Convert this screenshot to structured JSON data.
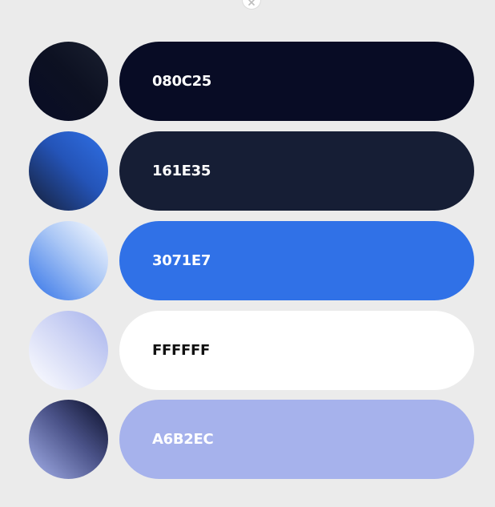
{
  "close_icon": "close-icon",
  "colors": [
    {
      "hex": "080C25",
      "text_color": "#ffffff",
      "pill_color": "#080c25",
      "swatch_gradient": [
        "#1a2030",
        "#0d1122",
        "#080c25"
      ]
    },
    {
      "hex": "161E35",
      "text_color": "#ffffff",
      "pill_color": "#161e35",
      "swatch_gradient": [
        "#3071e7",
        "#2454b8",
        "#161e35"
      ]
    },
    {
      "hex": "3071E7",
      "text_color": "#ffffff",
      "pill_color": "#3071e7",
      "swatch_gradient": [
        "#ffffff",
        "#a9c6f5",
        "#3071e7"
      ]
    },
    {
      "hex": "FFFFFF",
      "text_color": "#111111",
      "pill_color": "#ffffff",
      "swatch_gradient": [
        "#a6b2ec",
        "#d0d6f5",
        "#ffffff"
      ]
    },
    {
      "hex": "A6B2EC",
      "text_color": "#ffffff",
      "pill_color": "#a6b2ec",
      "swatch_gradient": [
        "#080c25",
        "#4a5288",
        "#a6b2ec"
      ]
    }
  ]
}
